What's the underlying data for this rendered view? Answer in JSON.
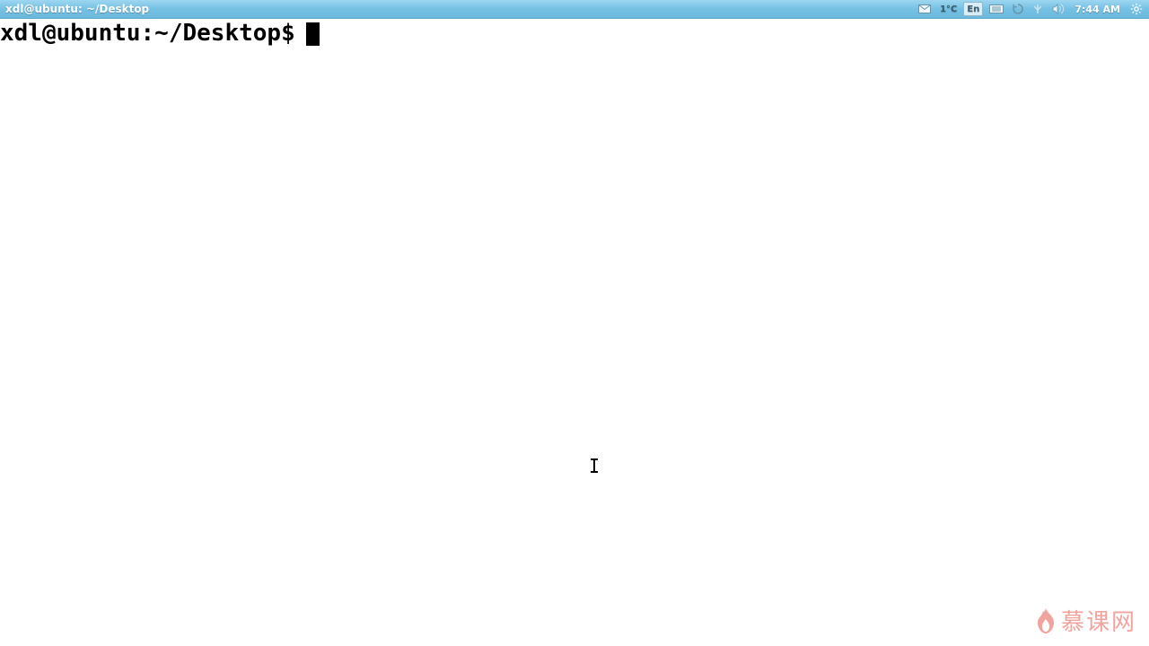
{
  "titlebar": {
    "title": "xdl@ubuntu: ~/Desktop"
  },
  "tray": {
    "weather": "1°C",
    "input_method": "En",
    "clock": "7:44 AM"
  },
  "terminal": {
    "prompt": "xdl@ubuntu:~/Desktop$",
    "input_value": ""
  },
  "watermark": {
    "text": "慕课网"
  }
}
